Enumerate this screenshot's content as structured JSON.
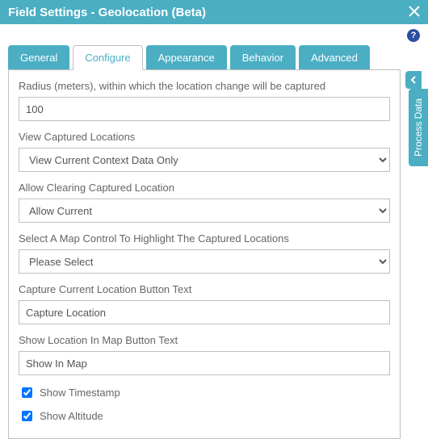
{
  "titlebar": {
    "title": "Field Settings - Geolocation (Beta)"
  },
  "tabs": {
    "general": "General",
    "configure": "Configure",
    "appearance": "Appearance",
    "behavior": "Behavior",
    "advanced": "Advanced"
  },
  "labels": {
    "radius": "Radius (meters), within which the location change will be captured",
    "view_captured": "View Captured Locations",
    "allow_clearing": "Allow Clearing Captured Location",
    "map_control": "Select A Map Control To Highlight The Captured Locations",
    "capture_btn_text": "Capture Current Location Button Text",
    "show_map_btn_text": "Show Location In Map Button Text",
    "show_timestamp": "Show Timestamp",
    "show_altitude": "Show Altitude"
  },
  "values": {
    "radius": "100",
    "view_captured": "View Current Context Data Only",
    "allow_clearing": "Allow Current",
    "map_control": "Please Select",
    "capture_btn_text": "Capture Location",
    "show_map_btn_text": "Show In Map"
  },
  "side": {
    "process_data": "Process Data"
  }
}
